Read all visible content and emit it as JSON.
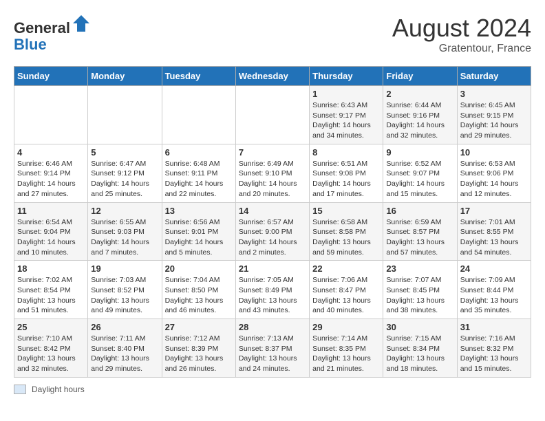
{
  "header": {
    "logo_line1": "General",
    "logo_line2": "Blue",
    "main_title": "August 2024",
    "subtitle": "Gratentour, France"
  },
  "days_of_week": [
    "Sunday",
    "Monday",
    "Tuesday",
    "Wednesday",
    "Thursday",
    "Friday",
    "Saturday"
  ],
  "weeks": [
    [
      {
        "num": "",
        "info": ""
      },
      {
        "num": "",
        "info": ""
      },
      {
        "num": "",
        "info": ""
      },
      {
        "num": "",
        "info": ""
      },
      {
        "num": "1",
        "info": "Sunrise: 6:43 AM\nSunset: 9:17 PM\nDaylight: 14 hours\nand 34 minutes."
      },
      {
        "num": "2",
        "info": "Sunrise: 6:44 AM\nSunset: 9:16 PM\nDaylight: 14 hours\nand 32 minutes."
      },
      {
        "num": "3",
        "info": "Sunrise: 6:45 AM\nSunset: 9:15 PM\nDaylight: 14 hours\nand 29 minutes."
      }
    ],
    [
      {
        "num": "4",
        "info": "Sunrise: 6:46 AM\nSunset: 9:14 PM\nDaylight: 14 hours\nand 27 minutes."
      },
      {
        "num": "5",
        "info": "Sunrise: 6:47 AM\nSunset: 9:12 PM\nDaylight: 14 hours\nand 25 minutes."
      },
      {
        "num": "6",
        "info": "Sunrise: 6:48 AM\nSunset: 9:11 PM\nDaylight: 14 hours\nand 22 minutes."
      },
      {
        "num": "7",
        "info": "Sunrise: 6:49 AM\nSunset: 9:10 PM\nDaylight: 14 hours\nand 20 minutes."
      },
      {
        "num": "8",
        "info": "Sunrise: 6:51 AM\nSunset: 9:08 PM\nDaylight: 14 hours\nand 17 minutes."
      },
      {
        "num": "9",
        "info": "Sunrise: 6:52 AM\nSunset: 9:07 PM\nDaylight: 14 hours\nand 15 minutes."
      },
      {
        "num": "10",
        "info": "Sunrise: 6:53 AM\nSunset: 9:06 PM\nDaylight: 14 hours\nand 12 minutes."
      }
    ],
    [
      {
        "num": "11",
        "info": "Sunrise: 6:54 AM\nSunset: 9:04 PM\nDaylight: 14 hours\nand 10 minutes."
      },
      {
        "num": "12",
        "info": "Sunrise: 6:55 AM\nSunset: 9:03 PM\nDaylight: 14 hours\nand 7 minutes."
      },
      {
        "num": "13",
        "info": "Sunrise: 6:56 AM\nSunset: 9:01 PM\nDaylight: 14 hours\nand 5 minutes."
      },
      {
        "num": "14",
        "info": "Sunrise: 6:57 AM\nSunset: 9:00 PM\nDaylight: 14 hours\nand 2 minutes."
      },
      {
        "num": "15",
        "info": "Sunrise: 6:58 AM\nSunset: 8:58 PM\nDaylight: 13 hours\nand 59 minutes."
      },
      {
        "num": "16",
        "info": "Sunrise: 6:59 AM\nSunset: 8:57 PM\nDaylight: 13 hours\nand 57 minutes."
      },
      {
        "num": "17",
        "info": "Sunrise: 7:01 AM\nSunset: 8:55 PM\nDaylight: 13 hours\nand 54 minutes."
      }
    ],
    [
      {
        "num": "18",
        "info": "Sunrise: 7:02 AM\nSunset: 8:54 PM\nDaylight: 13 hours\nand 51 minutes."
      },
      {
        "num": "19",
        "info": "Sunrise: 7:03 AM\nSunset: 8:52 PM\nDaylight: 13 hours\nand 49 minutes."
      },
      {
        "num": "20",
        "info": "Sunrise: 7:04 AM\nSunset: 8:50 PM\nDaylight: 13 hours\nand 46 minutes."
      },
      {
        "num": "21",
        "info": "Sunrise: 7:05 AM\nSunset: 8:49 PM\nDaylight: 13 hours\nand 43 minutes."
      },
      {
        "num": "22",
        "info": "Sunrise: 7:06 AM\nSunset: 8:47 PM\nDaylight: 13 hours\nand 40 minutes."
      },
      {
        "num": "23",
        "info": "Sunrise: 7:07 AM\nSunset: 8:45 PM\nDaylight: 13 hours\nand 38 minutes."
      },
      {
        "num": "24",
        "info": "Sunrise: 7:09 AM\nSunset: 8:44 PM\nDaylight: 13 hours\nand 35 minutes."
      }
    ],
    [
      {
        "num": "25",
        "info": "Sunrise: 7:10 AM\nSunset: 8:42 PM\nDaylight: 13 hours\nand 32 minutes."
      },
      {
        "num": "26",
        "info": "Sunrise: 7:11 AM\nSunset: 8:40 PM\nDaylight: 13 hours\nand 29 minutes."
      },
      {
        "num": "27",
        "info": "Sunrise: 7:12 AM\nSunset: 8:39 PM\nDaylight: 13 hours\nand 26 minutes."
      },
      {
        "num": "28",
        "info": "Sunrise: 7:13 AM\nSunset: 8:37 PM\nDaylight: 13 hours\nand 24 minutes."
      },
      {
        "num": "29",
        "info": "Sunrise: 7:14 AM\nSunset: 8:35 PM\nDaylight: 13 hours\nand 21 minutes."
      },
      {
        "num": "30",
        "info": "Sunrise: 7:15 AM\nSunset: 8:34 PM\nDaylight: 13 hours\nand 18 minutes."
      },
      {
        "num": "31",
        "info": "Sunrise: 7:16 AM\nSunset: 8:32 PM\nDaylight: 13 hours\nand 15 minutes."
      }
    ]
  ],
  "footer": {
    "legend_label": "Daylight hours"
  }
}
